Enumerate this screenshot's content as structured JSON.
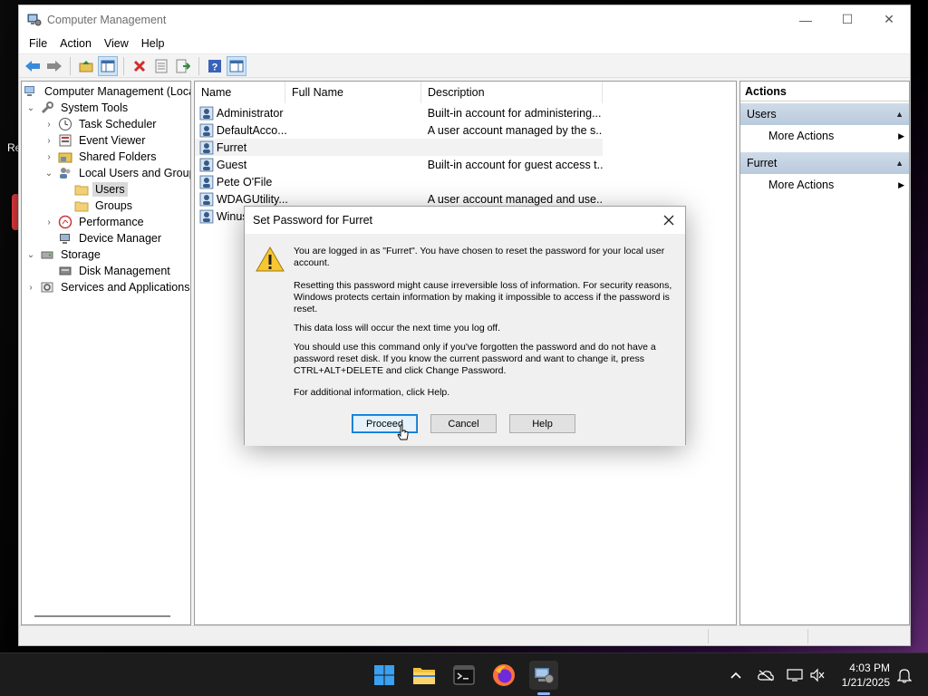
{
  "desktop": {
    "partial_text": "Re"
  },
  "window": {
    "title": "Computer Management",
    "controls": {
      "minimize": "—",
      "maximize": "☐",
      "close": "✕"
    }
  },
  "menu": [
    "File",
    "Action",
    "View",
    "Help"
  ],
  "tree": {
    "root": "Computer Management (Local",
    "system_tools": "System Tools",
    "task_scheduler": "Task Scheduler",
    "event_viewer": "Event Viewer",
    "shared_folders": "Shared Folders",
    "local_users_groups": "Local Users and Groups",
    "users": "Users",
    "groups": "Groups",
    "performance": "Performance",
    "device_manager": "Device Manager",
    "storage": "Storage",
    "disk_management": "Disk Management",
    "services_apps": "Services and Applications"
  },
  "list": {
    "columns": [
      "Name",
      "Full Name",
      "Description"
    ],
    "rows": [
      {
        "name": "Administrator",
        "full": "",
        "desc": "Built-in account for administering..."
      },
      {
        "name": "DefaultAcco...",
        "full": "",
        "desc": "A user account managed by the s..."
      },
      {
        "name": "Furret",
        "full": "",
        "desc": ""
      },
      {
        "name": "Guest",
        "full": "",
        "desc": "Built-in account for guest access t..."
      },
      {
        "name": "Pete O'File",
        "full": "",
        "desc": ""
      },
      {
        "name": "WDAGUtility...",
        "full": "",
        "desc": "A user account managed and use..."
      },
      {
        "name": "Winus",
        "full": "",
        "desc": ""
      }
    ]
  },
  "actions": {
    "header": "Actions",
    "section1": "Users",
    "section1_item": "More Actions",
    "section2": "Furret",
    "section2_item": "More Actions"
  },
  "dialog": {
    "title": "Set Password for Furret",
    "p1": "You are logged in as \"Furret\". You have chosen to reset the password for your local user account.",
    "p2": "Resetting this password might cause irreversible loss of information. For security reasons, Windows protects certain information by making it impossible to access if the password is reset.",
    "p3": "This data loss will occur the next time you log off.",
    "p4": "You should use this command only if you've forgotten the password and do not have a password reset disk. If you know the current password and want to change it, press CTRL+ALT+DELETE and click Change Password.",
    "p5": "For additional information, click Help.",
    "proceed": "Proceed",
    "cancel": "Cancel",
    "help": "Help"
  },
  "taskbar": {
    "time": "4:03 PM",
    "date": "1/21/2025"
  },
  "colors": {
    "accent": "#0078d7",
    "taskbar": "#1c1c1c",
    "actions_section": "#c4d3e4"
  }
}
